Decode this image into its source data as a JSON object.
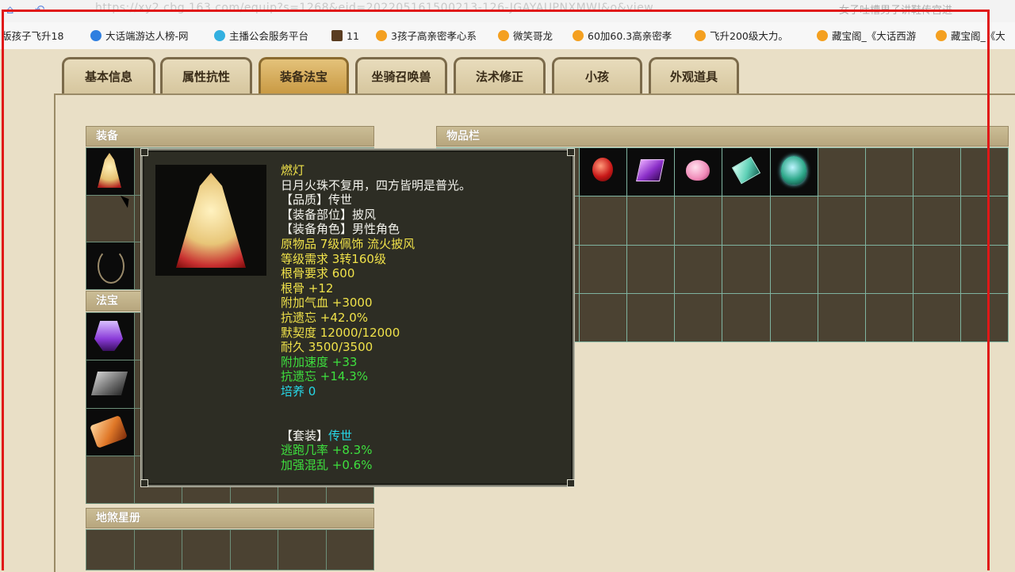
{
  "browser": {
    "url": "https://xy2.cbg.163.com/equip?s=1268&eid=202205161500213-126-JGAYAUPNXMWI&o&view",
    "right_text": "女子吐槽男子讲鞋传宫进",
    "bookmarks": [
      {
        "label": "版孩子飞升18",
        "icon": "none"
      },
      {
        "label": "大话端游达人榜-网",
        "icon": "blue-c-icon"
      },
      {
        "label": "主播公会服务平台",
        "icon": "cyan-icon"
      },
      {
        "label": "11",
        "icon": "game-icon"
      },
      {
        "label": "3孩子高亲密孝心系",
        "icon": "chick-icon"
      },
      {
        "label": "微笑哥龙",
        "icon": "chick-icon"
      },
      {
        "label": "60加60.3高亲密孝",
        "icon": "chick-icon"
      },
      {
        "label": "飞升200级大力。",
        "icon": "chick-icon"
      },
      {
        "label": "藏宝阁_《大话西游",
        "icon": "chick-icon"
      },
      {
        "label": "藏宝阁_《大",
        "icon": "chick-icon"
      }
    ]
  },
  "tabs": [
    {
      "label": "基本信息",
      "active": false
    },
    {
      "label": "属性抗性",
      "active": false
    },
    {
      "label": "装备法宝",
      "active": true
    },
    {
      "label": "坐骑召唤兽",
      "active": false
    },
    {
      "label": "法术修正",
      "active": false
    },
    {
      "label": "小孩",
      "active": false
    },
    {
      "label": "外观道具",
      "active": false
    }
  ],
  "sections": {
    "equipment": "装备",
    "fabao": "法宝",
    "inventory": "物品栏",
    "disha": "地煞星册"
  },
  "tooltip": {
    "name": "燃灯",
    "description": "日月火珠不复用，四方皆明是普光。",
    "lines": [
      {
        "text": "【品质】传世",
        "color": "white"
      },
      {
        "text": "【装备部位】披风",
        "color": "white"
      },
      {
        "text": "【装备角色】男性角色",
        "color": "white"
      },
      {
        "text": "原物品 7级佩饰 流火披风",
        "color": "yellow"
      },
      {
        "text": "等级需求 3转160级",
        "color": "yellow"
      },
      {
        "text": "根骨要求 600",
        "color": "yellow"
      },
      {
        "text": "根骨 +12",
        "color": "yellow"
      },
      {
        "text": "附加气血 +3000",
        "color": "yellow"
      },
      {
        "text": "抗遗忘 +42.0%",
        "color": "yellow"
      },
      {
        "text": "默契度 12000/12000",
        "color": "yellow"
      },
      {
        "text": "耐久 3500/3500",
        "color": "yellow"
      },
      {
        "text": "附加速度 +33",
        "color": "green"
      },
      {
        "text": "抗遗忘 +14.3%",
        "color": "green"
      },
      {
        "text": "培养 0",
        "color": "cyan"
      },
      {
        "text": "",
        "color": "white"
      },
      {
        "text": "",
        "color": "white"
      }
    ],
    "set_label": "【套装】",
    "set_name": "传世",
    "set_lines": [
      "逃跑几率 +8.3%",
      "加强混乱 +0.6%"
    ]
  }
}
